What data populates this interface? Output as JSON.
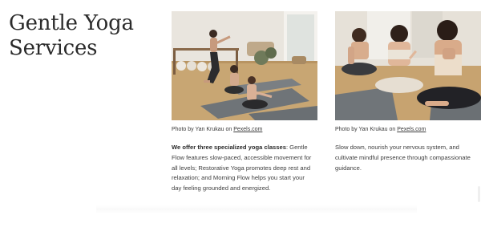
{
  "page": {
    "title_line1": "Gentle Yoga",
    "title_line2": "Services"
  },
  "photos": [
    {
      "credit_prefix": "Photo by Yan Krukau on ",
      "credit_link": "Pexels.com",
      "icon": "yoga-class-photo"
    },
    {
      "credit_prefix": "Photo by Yan Krukau on ",
      "credit_link": "Pexels.com",
      "icon": "meditation-class-photo"
    }
  ],
  "descriptions": {
    "left_intro": "We offer three specialized yoga classes",
    "left_body": ": Gentle Flow features slow-paced, accessible movement for all levels; Restorative Yoga promotes deep rest and relaxation; and Morning Flow helps you start your day feeling grounded and energized.",
    "right_body": "Slow down, nourish your nervous system, and cultivate mindful presence through compassionate guidance."
  },
  "colors": {
    "text": "#2e2e2e",
    "floor": "#c9a878",
    "mat": "#6f7478",
    "wall": "#e8e4dd"
  }
}
